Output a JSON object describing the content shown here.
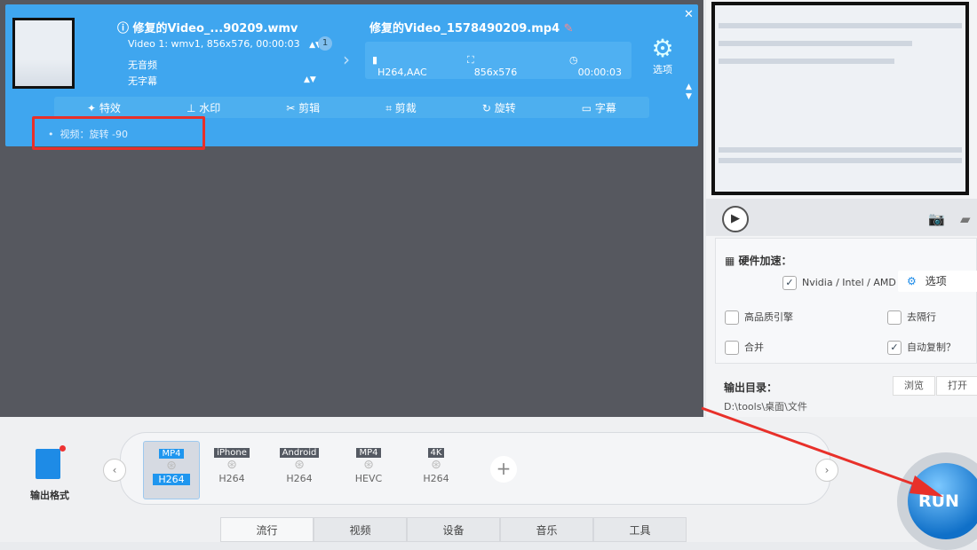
{
  "task": {
    "source_title": "修复的Video_...90209.wmv",
    "source_info": "Video 1: wmv1, 856x576, 00:00:03",
    "track_count": "1",
    "audio": "无音频",
    "subtitle": "无字幕",
    "output_title": "修复的Video_1578490209.mp4",
    "codec": "H264,AAC",
    "resolution": "856x576",
    "duration": "00:00:03",
    "codec_label": "codec",
    "options_label": "选项",
    "effect_note": "视频：旋转 -90",
    "tools": [
      "特效",
      "水印",
      "剪辑",
      "剪裁",
      "旋转",
      "字幕"
    ]
  },
  "settings": {
    "hw_accel": "硬件加速：",
    "hw_option": "Nvidia / Intel / AMD",
    "options_button": "选项",
    "hq_engine": "高品质引擎",
    "deinterlace": "去隔行",
    "merge": "合并",
    "auto_copy": "自动复制？"
  },
  "output": {
    "label": "输出目录：",
    "path": "D:\\tools\\桌面\\文件",
    "browse": "浏览",
    "open": "打开"
  },
  "format": {
    "label": "输出格式",
    "presets": [
      {
        "tag": "MP4",
        "codec": "H264"
      },
      {
        "tag": "iPhone",
        "codec": "H264"
      },
      {
        "tag": "Android",
        "codec": "H264"
      },
      {
        "tag": "MP4",
        "codec": "HEVC"
      },
      {
        "tag": "4K",
        "codec": "H264"
      }
    ]
  },
  "tabs": [
    "流行",
    "视频",
    "设备",
    "音乐",
    "工具"
  ],
  "run_label": "RUN"
}
